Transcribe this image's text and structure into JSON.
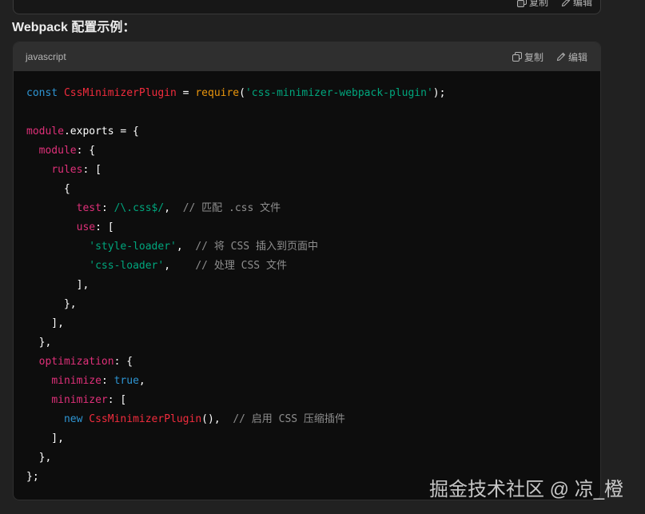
{
  "prev_block": {
    "copy_label": "复制",
    "edit_label": "编辑"
  },
  "heading": "Webpack 配置示例：",
  "code_block": {
    "language": "javascript",
    "copy_label": "复制",
    "edit_label": "编辑",
    "lines": [
      [
        [
          "kw",
          "const "
        ],
        [
          "cls",
          "CssMinimizerPlugin"
        ],
        [
          "pl",
          " = "
        ],
        [
          "builtin",
          "require"
        ],
        [
          "pl",
          "("
        ],
        [
          "str",
          "'css-minimizer-webpack-plugin'"
        ],
        [
          "pl",
          ");"
        ]
      ],
      [],
      [
        [
          "prop",
          "module"
        ],
        [
          "pl",
          ".exports = {"
        ]
      ],
      [
        [
          "pl",
          "  "
        ],
        [
          "prop",
          "module"
        ],
        [
          "pl",
          ": {"
        ]
      ],
      [
        [
          "pl",
          "    "
        ],
        [
          "prop",
          "rules"
        ],
        [
          "pl",
          ": ["
        ]
      ],
      [
        [
          "pl",
          "      {"
        ]
      ],
      [
        [
          "pl",
          "        "
        ],
        [
          "prop",
          "test"
        ],
        [
          "pl",
          ": "
        ],
        [
          "str",
          "/\\.css$/"
        ],
        [
          "pl",
          ",  "
        ],
        [
          "cm",
          "// 匹配 .css 文件"
        ]
      ],
      [
        [
          "pl",
          "        "
        ],
        [
          "prop",
          "use"
        ],
        [
          "pl",
          ": ["
        ]
      ],
      [
        [
          "pl",
          "          "
        ],
        [
          "str",
          "'style-loader'"
        ],
        [
          "pl",
          ",  "
        ],
        [
          "cm",
          "// 将 CSS 插入到页面中"
        ]
      ],
      [
        [
          "pl",
          "          "
        ],
        [
          "str",
          "'css-loader'"
        ],
        [
          "pl",
          ",    "
        ],
        [
          "cm",
          "// 处理 CSS 文件"
        ]
      ],
      [
        [
          "pl",
          "        ],"
        ]
      ],
      [
        [
          "pl",
          "      },"
        ]
      ],
      [
        [
          "pl",
          "    ],"
        ]
      ],
      [
        [
          "pl",
          "  },"
        ]
      ],
      [
        [
          "pl",
          "  "
        ],
        [
          "prop",
          "optimization"
        ],
        [
          "pl",
          ": {"
        ]
      ],
      [
        [
          "pl",
          "    "
        ],
        [
          "prop",
          "minimize"
        ],
        [
          "pl",
          ": "
        ],
        [
          "kw",
          "true"
        ],
        [
          "pl",
          ","
        ]
      ],
      [
        [
          "pl",
          "    "
        ],
        [
          "prop",
          "minimizer"
        ],
        [
          "pl",
          ": ["
        ]
      ],
      [
        [
          "pl",
          "      "
        ],
        [
          "kw",
          "new "
        ],
        [
          "cls",
          "CssMinimizerPlugin"
        ],
        [
          "pl",
          "(),  "
        ],
        [
          "cm",
          "// 启用 CSS 压缩插件"
        ]
      ],
      [
        [
          "pl",
          "    ],"
        ]
      ],
      [
        [
          "pl",
          "  },"
        ]
      ],
      [
        [
          "pl",
          "};"
        ]
      ]
    ]
  },
  "watermark": "掘金技术社区 @ 凉_橙",
  "icons": {
    "copy": "copy-icon",
    "edit": "edit-icon"
  },
  "colors": {
    "background": "#212121",
    "code_bg": "#0d0d0d",
    "header_bg": "#2f2f2f",
    "keyword": "#2e95d3",
    "class_name": "#f22c3d",
    "property": "#df3079",
    "string": "#00a67d",
    "comment": "#8e8e8e",
    "builtin": "#e9950c"
  }
}
